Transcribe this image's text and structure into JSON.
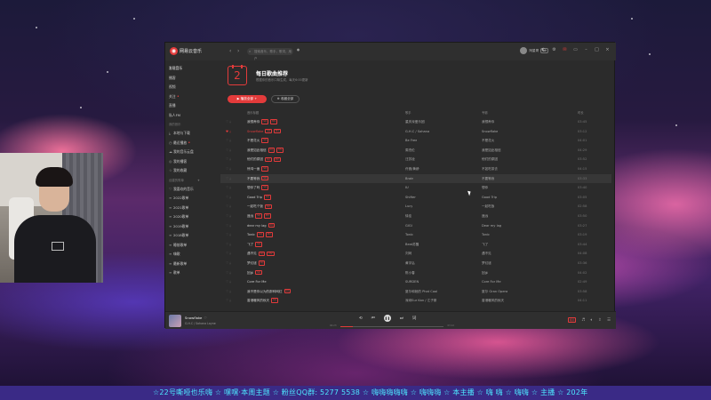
{
  "app": {
    "name": "网易云音乐",
    "search_placeholder": "搜索音乐，歌手，歌词，用户",
    "user_name": "阿星哥",
    "vip_label": "VIP"
  },
  "sidebar": {
    "items": [
      {
        "label": "发现音乐",
        "active": true
      },
      {
        "label": "播客"
      },
      {
        "label": "视频"
      },
      {
        "label": "关注",
        "badge": "•"
      },
      {
        "label": "直播"
      },
      {
        "label": "私人FM"
      }
    ],
    "section_my": "我的音乐",
    "my_items": [
      {
        "icon": "download-icon",
        "label": "本地与下载"
      },
      {
        "icon": "clock-icon",
        "label": "最近播放",
        "badge": "•"
      },
      {
        "icon": "cloud-icon",
        "label": "我的音乐云盘"
      },
      {
        "icon": "podcast-icon",
        "label": "我的播客"
      },
      {
        "icon": "star-icon",
        "label": "我的收藏"
      }
    ],
    "section_playlists": "创建的歌单",
    "playlists": [
      {
        "icon": "heart-icon",
        "label": "我喜欢的音乐"
      },
      {
        "icon": "playlist-icon",
        "label": "2022歌单"
      },
      {
        "icon": "playlist-icon",
        "label": "2021歌单"
      },
      {
        "icon": "playlist-icon",
        "label": "2020歌单"
      },
      {
        "icon": "playlist-icon",
        "label": "2019歌单"
      },
      {
        "icon": "playlist-icon",
        "label": "2018歌单"
      },
      {
        "icon": "playlist-icon",
        "label": "睡前歌单"
      },
      {
        "icon": "playlist-icon",
        "label": "嗨歌"
      },
      {
        "icon": "playlist-icon",
        "label": "最新歌单"
      },
      {
        "icon": "playlist-icon",
        "label": "歌单"
      }
    ]
  },
  "main": {
    "calendar_day": "2",
    "title": "每日歌曲推荐",
    "subtitle": "根据你的音乐口味生成，每天6:00更新",
    "play_all_label": "▶ 播放全部 +",
    "collect_label": "⊕ 收藏全部",
    "columns": {
      "title": "音乐标题",
      "artist": "歌手",
      "album": "专辑",
      "duration": "时长"
    },
    "rows": [
      {
        "title": "我想养你",
        "tags": [
          "SQ",
          "MV"
        ],
        "artist": "重庆深爱乐团",
        "album": "我想养你",
        "duration": "03:45"
      },
      {
        "title": "Snowflake",
        "tags": [
          "SQ",
          "MV"
        ],
        "artist": "G.H.C / Sohana",
        "album": "Snowflake",
        "duration": "03:12",
        "playing": true,
        "liked": true
      },
      {
        "title": "不是花火",
        "tags": [
          "SQ"
        ],
        "artist": "Be Free",
        "album": "不是花火",
        "duration": "04:01"
      },
      {
        "title": "我是如此相信",
        "tags": [
          "SQ",
          "MV"
        ],
        "artist": "周杰伦",
        "album": "我是如此相信",
        "duration": "04:29"
      },
      {
        "title": "他们的原因",
        "tags": [
          "SQ",
          "MV"
        ],
        "artist": "汪苏泷",
        "album": "他们的原因",
        "duration": "03:52"
      },
      {
        "title": "惊鸿一面",
        "tags": [
          "SQ"
        ],
        "artist": "许嵩/黄龄",
        "album": "不如吃茶去",
        "duration": "04:15"
      },
      {
        "title": "不要等我",
        "tags": [
          "SQ"
        ],
        "artist": "Brain",
        "album": "不要等我",
        "duration": "03:33",
        "hover": true
      },
      {
        "title": "想你了吗",
        "tags": [
          "SQ"
        ],
        "artist": "IU",
        "album": "想你",
        "duration": "03:40"
      },
      {
        "title": "Good Trip",
        "tags": [
          "SQ"
        ],
        "artist": "Shifter",
        "album": "Good Trip",
        "duration": "03:05"
      },
      {
        "title": "一起吃个饭",
        "tags": [
          "SQ"
        ],
        "artist": "Lucy",
        "album": "一起吃饭",
        "duration": "02:58"
      },
      {
        "title": "遥远",
        "tags": [
          "SQ",
          "MV"
        ],
        "artist": "徐佳",
        "album": "遥远",
        "duration": "03:50"
      },
      {
        "title": "dear my lag",
        "tags": [
          "SQ"
        ],
        "artist": "GIGI",
        "album": "Dear my lag",
        "duration": "03:27"
      },
      {
        "title": "Tonic",
        "tags": [
          "SQ",
          "MV"
        ],
        "artist": "Tonic",
        "album": "Tonic",
        "duration": "03:19"
      },
      {
        "title": "飞了",
        "tags": [
          "SQ"
        ],
        "artist": "Beat苏醒",
        "album": "飞了",
        "duration": "03:44"
      },
      {
        "title": "遇不见",
        "tags": [
          "SQ",
          "MV"
        ],
        "artist": "刘珂",
        "album": "遇不见",
        "duration": "04:08"
      },
      {
        "title": "梦幻谜",
        "tags": [
          "SQ"
        ],
        "artist": "黄宇弘",
        "album": "梦幻谜",
        "duration": "03:36"
      },
      {
        "title": "回乡",
        "tags": [
          "SQ"
        ],
        "artist": "陈小春",
        "album": "回乡",
        "duration": "04:02"
      },
      {
        "title": "Core For Me",
        "tags": [],
        "artist": "SURDEN",
        "album": "Core For Me",
        "duration": "02:49"
      },
      {
        "title": "我不是你以为的那种网红",
        "tags": [
          "SQ"
        ],
        "artist": "夏尔和她的 Phat Cool",
        "album": "夏尔 Gran Opera",
        "duration": "03:58"
      },
      {
        "title": "香港暖风的秋天",
        "tags": [
          "SQ"
        ],
        "artist": "深圳Sur Kan / 江子期",
        "album": "香港暖风的秋天",
        "duration": "04:11"
      }
    ]
  },
  "player": {
    "title": "Snowflake",
    "artist": "G.H.C / Sohana Layne",
    "time_current": "00:23",
    "time_total": "03:12",
    "progress": 0.12,
    "quality_label": "极高"
  },
  "marquee_text": "☆22号嘶哑也乐嗨 ☆ 嘿嘿·本周主题 ☆ 粉丝QQ群: 5277 5538 ☆ 嗨嗨嗨嗨嗨 ☆ 嗨嗨嗨 ☆ 本主播 ☆ 嗨 嗨 ☆ 嗨嗨 ☆ 主播 ☆ 202年"
}
